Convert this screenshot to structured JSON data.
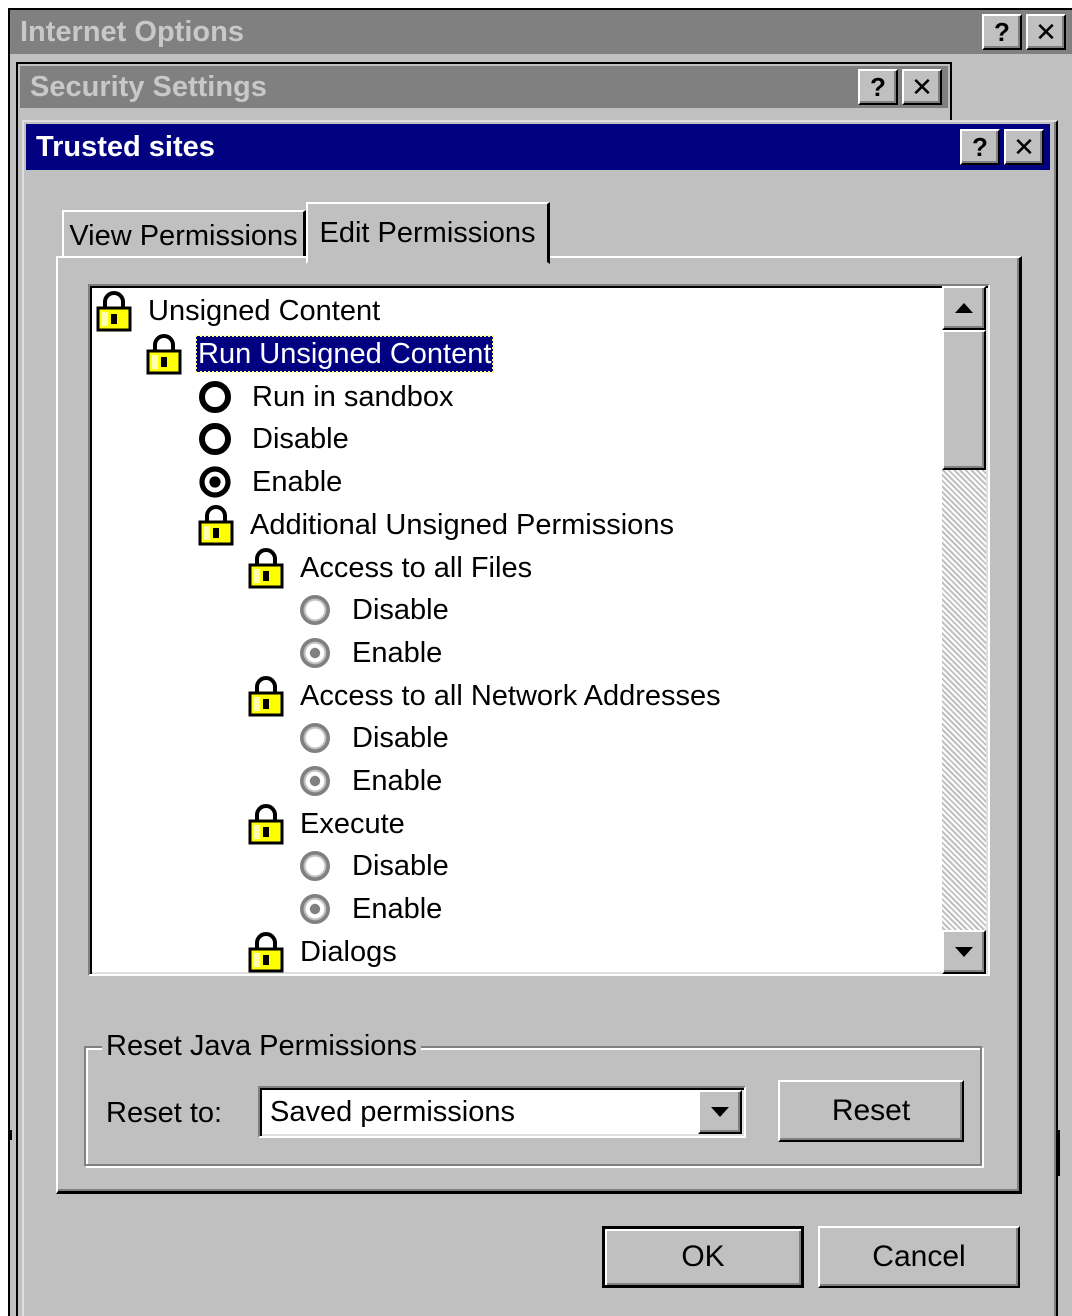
{
  "windows": {
    "internet_options": {
      "title": "Internet Options",
      "help": "?",
      "close": "✕"
    },
    "security_settings": {
      "title": "Security Settings",
      "help": "?",
      "close": "✕"
    },
    "trusted_sites": {
      "title": "Trusted sites",
      "help": "?",
      "close": "✕"
    }
  },
  "tabs": [
    {
      "label": "View Permissions",
      "active": false
    },
    {
      "label": "Edit Permissions",
      "active": true
    }
  ],
  "tree": {
    "root": "Unsigned Content",
    "run_unsigned": "Run Unsigned Content",
    "run_options": [
      {
        "label": "Run in sandbox",
        "checked": false
      },
      {
        "label": "Disable",
        "checked": false
      },
      {
        "label": "Enable",
        "checked": true
      }
    ],
    "additional": "Additional Unsigned Permissions",
    "groups": [
      {
        "label": "Access to all Files",
        "options": [
          {
            "label": "Disable",
            "checked": false
          },
          {
            "label": "Enable",
            "checked": true
          }
        ]
      },
      {
        "label": "Access to all Network Addresses",
        "options": [
          {
            "label": "Disable",
            "checked": false
          },
          {
            "label": "Enable",
            "checked": true
          }
        ]
      },
      {
        "label": "Execute",
        "options": [
          {
            "label": "Disable",
            "checked": false
          },
          {
            "label": "Enable",
            "checked": true
          }
        ]
      },
      {
        "label": "Dialogs"
      }
    ]
  },
  "scrollbar": {
    "up_icon": "scroll-up-arrow",
    "down_icon": "scroll-down-arrow"
  },
  "reset_group": {
    "title": "Reset Java Permissions",
    "reset_to_label": "Reset to:",
    "selected": "Saved permissions",
    "reset_button": "Reset"
  },
  "buttons": {
    "ok": "OK",
    "cancel": "Cancel"
  }
}
